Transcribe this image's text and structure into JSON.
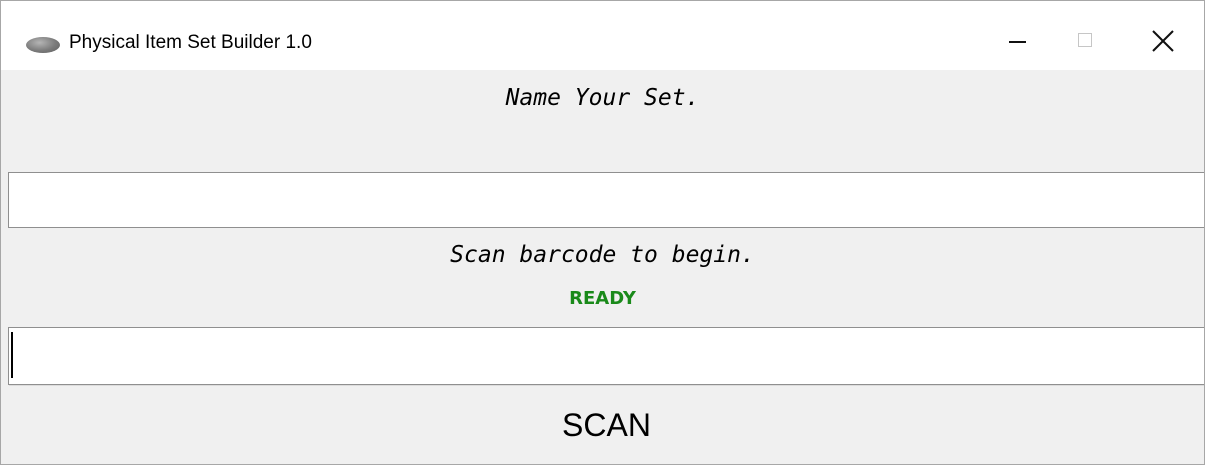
{
  "window": {
    "title": "Physical Item Set Builder 1.0",
    "icon": "gray-disc-icon"
  },
  "titlebar_buttons": {
    "minimize_icon": "minimize-icon",
    "maximize_icon": "maximize-icon",
    "close_icon": "close-icon"
  },
  "name_section": {
    "label": "Name Your Set.",
    "input_value": "",
    "input_placeholder": ""
  },
  "scan_section": {
    "label": "Scan barcode to begin.",
    "status": "READY",
    "input_value": "",
    "input_placeholder": ""
  },
  "scan_button": {
    "label": "SCAN"
  },
  "colors": {
    "background": "#f0f0f0",
    "titlebar": "#ffffff",
    "status_ready": "#1a8a1a",
    "input_background": "#ffffff",
    "input_border": "#8f8f8f"
  }
}
